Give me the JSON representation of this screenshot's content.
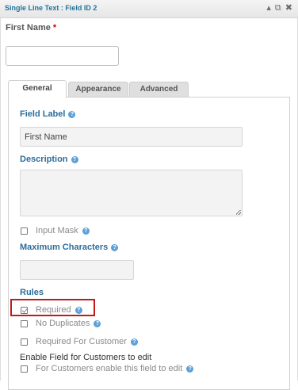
{
  "header": {
    "title": "Single Line Text : Field ID 2"
  },
  "preview": {
    "label": "First Name",
    "required_mark": "*",
    "value": ""
  },
  "tabs": [
    {
      "label": "General",
      "active": true
    },
    {
      "label": "Appearance",
      "active": false
    },
    {
      "label": "Advanced",
      "active": false
    }
  ],
  "general": {
    "field_label": {
      "title": "Field Label",
      "value": "First Name"
    },
    "description": {
      "title": "Description",
      "value": ""
    },
    "input_mask": {
      "label": "Input Mask",
      "checked": false
    },
    "max_chars": {
      "title": "Maximum Characters",
      "value": ""
    },
    "rules": {
      "title": "Rules",
      "required": {
        "label": "Required",
        "checked": true
      },
      "no_duplicates": {
        "label": "No Duplicates",
        "checked": false
      },
      "required_customer": {
        "label": "Required For Customer",
        "checked": false
      }
    },
    "enable_customers": {
      "title": "Enable Field for Customers to edit",
      "option": {
        "label": "For Customers enable this field to edit",
        "checked": false
      }
    }
  },
  "colors": {
    "accent": "#2c6c9c",
    "header_title": "#21759b",
    "highlight": "#c21a1a",
    "help_icon": "#5d9fd6"
  }
}
